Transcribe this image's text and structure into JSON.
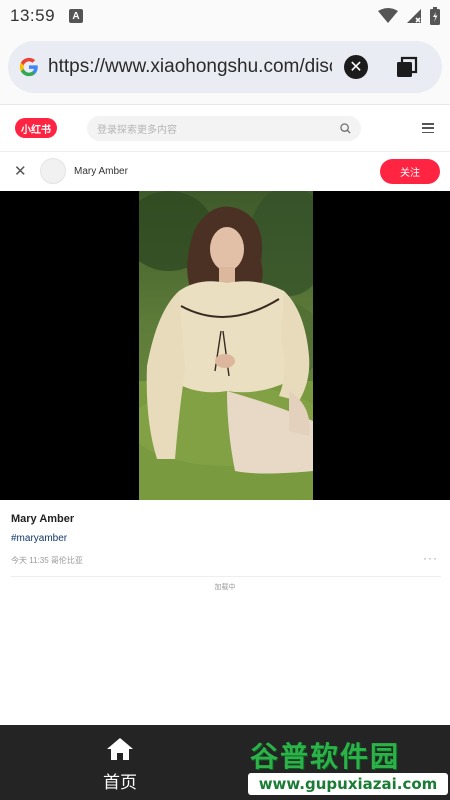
{
  "status_bar": {
    "time": "13:59",
    "a_badge": "A"
  },
  "browser": {
    "url": "https://www.xiaohongshu.com/discovery/item/",
    "clear_glyph": "✕"
  },
  "site": {
    "logo_text": "小红书",
    "search_placeholder": "登录探索更多内容"
  },
  "author_bar": {
    "close_glyph": "✕",
    "name": "Mary Amber",
    "follow_label": "关注"
  },
  "post": {
    "title": "Mary Amber",
    "tag": "#maryamber",
    "meta": "今天 11:35 哥伦比亚",
    "more": "···",
    "loading": "加载中"
  },
  "bottom_nav": {
    "home_label": "首页"
  },
  "watermark": {
    "title": "谷普软件园",
    "url": "www.gupuxiazai.com"
  },
  "colors": {
    "brand": "#ff2442",
    "tag": "#13386c",
    "nav_bg": "#242424",
    "watermark": "#2db24a"
  }
}
